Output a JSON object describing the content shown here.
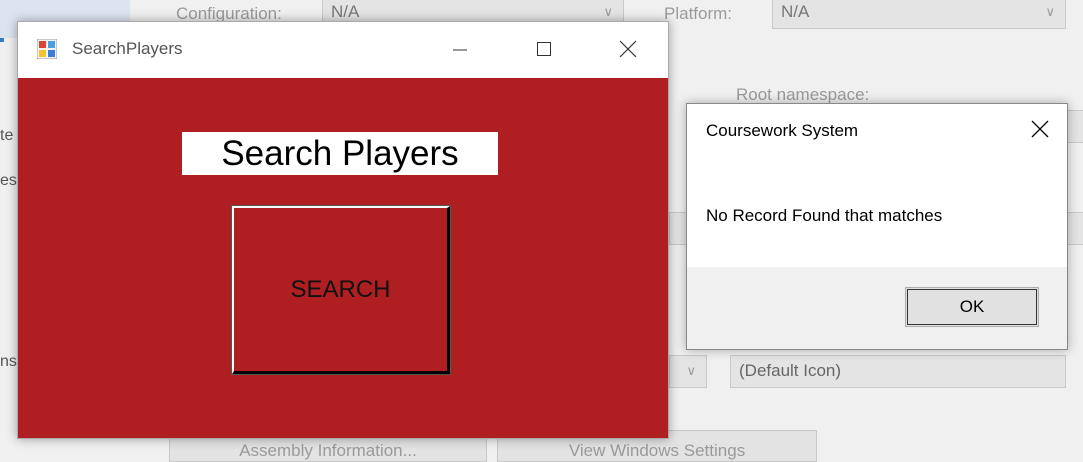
{
  "background": {
    "configuration_label": "Configuration:",
    "configuration_value": "N/A",
    "platform_label": "Platform:",
    "platform_value": "N/A",
    "root_namespace_label": "Root namespace:",
    "icon_value": "(Default Icon)",
    "assembly_info_button": "Assembly Information...",
    "view_windows_settings_button": "View Windows Settings",
    "fragments": [
      "te",
      "es",
      "ns"
    ]
  },
  "search_window": {
    "title": "SearchPlayers",
    "heading": "Search Players",
    "search_button": "SEARCH",
    "client_color": "#af1f22"
  },
  "message_box": {
    "title": "Coursework System",
    "message": "No Record Found that matches",
    "ok_button": "OK"
  }
}
